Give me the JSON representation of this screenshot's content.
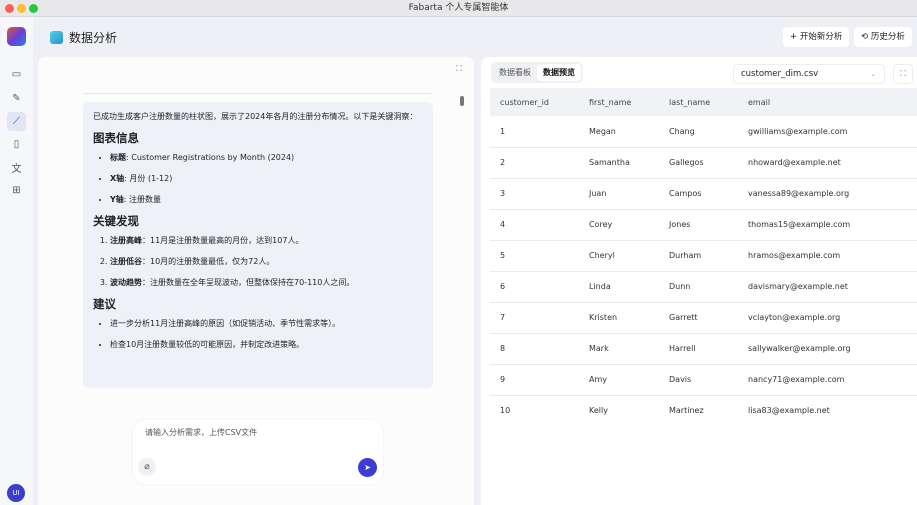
{
  "window": {
    "title": "Fabarta 个人专属智能体"
  },
  "sidebar": {
    "avatar": "UI",
    "items": [
      "chat",
      "edit",
      "analytics",
      "book",
      "translate",
      "apps"
    ]
  },
  "header": {
    "title": "数据分析",
    "new_analysis": "开始新分析",
    "history": "历史分析"
  },
  "chat": {
    "intro": "已成功生成客户注册数量的柱状图，展示了2024年各月的注册分布情况。以下是关键洞察：",
    "h1": "图表信息",
    "chart_info": [
      {
        "k": "标题",
        "v": ": Customer Registrations by Month (2024)"
      },
      {
        "k": "X轴",
        "v": ": 月份 (1-12)"
      },
      {
        "k": "Y轴",
        "v": ": 注册数量"
      }
    ],
    "h2": "关键发现",
    "findings": [
      {
        "k": "注册高峰",
        "v": "：11月是注册数量最高的月份，达到107人。"
      },
      {
        "k": "注册低谷",
        "v": "：10月的注册数量最低，仅为72人。"
      },
      {
        "k": "波动趋势",
        "v": "：注册数量在全年呈现波动，但整体保持在70-110人之间。"
      }
    ],
    "h3": "建议",
    "suggestions": [
      "进一步分析11月注册高峰的原因（如促销活动、季节性需求等）。",
      "检查10月注册数量较低的可能原因，并制定改进策略。"
    ],
    "input_placeholder": "请输入分析需求，上传CSV文件"
  },
  "preview": {
    "tabs": [
      "数据看板",
      "数据预览"
    ],
    "file": "customer_dim.csv",
    "columns": [
      "customer_id",
      "first_name",
      "last_name",
      "email"
    ],
    "rows": [
      [
        "1",
        "Megan",
        "Chang",
        "gwilliams@example.com"
      ],
      [
        "2",
        "Samantha",
        "Gallegos",
        "nhoward@example.net"
      ],
      [
        "3",
        "Juan",
        "Campos",
        "vanessa89@example.org"
      ],
      [
        "4",
        "Corey",
        "Jones",
        "thomas15@example.com"
      ],
      [
        "5",
        "Cheryl",
        "Durham",
        "hramos@example.com"
      ],
      [
        "6",
        "Linda",
        "Dunn",
        "davismary@example.net"
      ],
      [
        "7",
        "Kristen",
        "Garrett",
        "vclayton@example.org"
      ],
      [
        "8",
        "Mark",
        "Harrell",
        "sallywalker@example.org"
      ],
      [
        "9",
        "Amy",
        "Davis",
        "nancy71@example.com"
      ],
      [
        "10",
        "Kelly",
        "Martinez",
        "lisa83@example.net"
      ]
    ]
  },
  "colors": {
    "accent": "#3b3fd1"
  }
}
